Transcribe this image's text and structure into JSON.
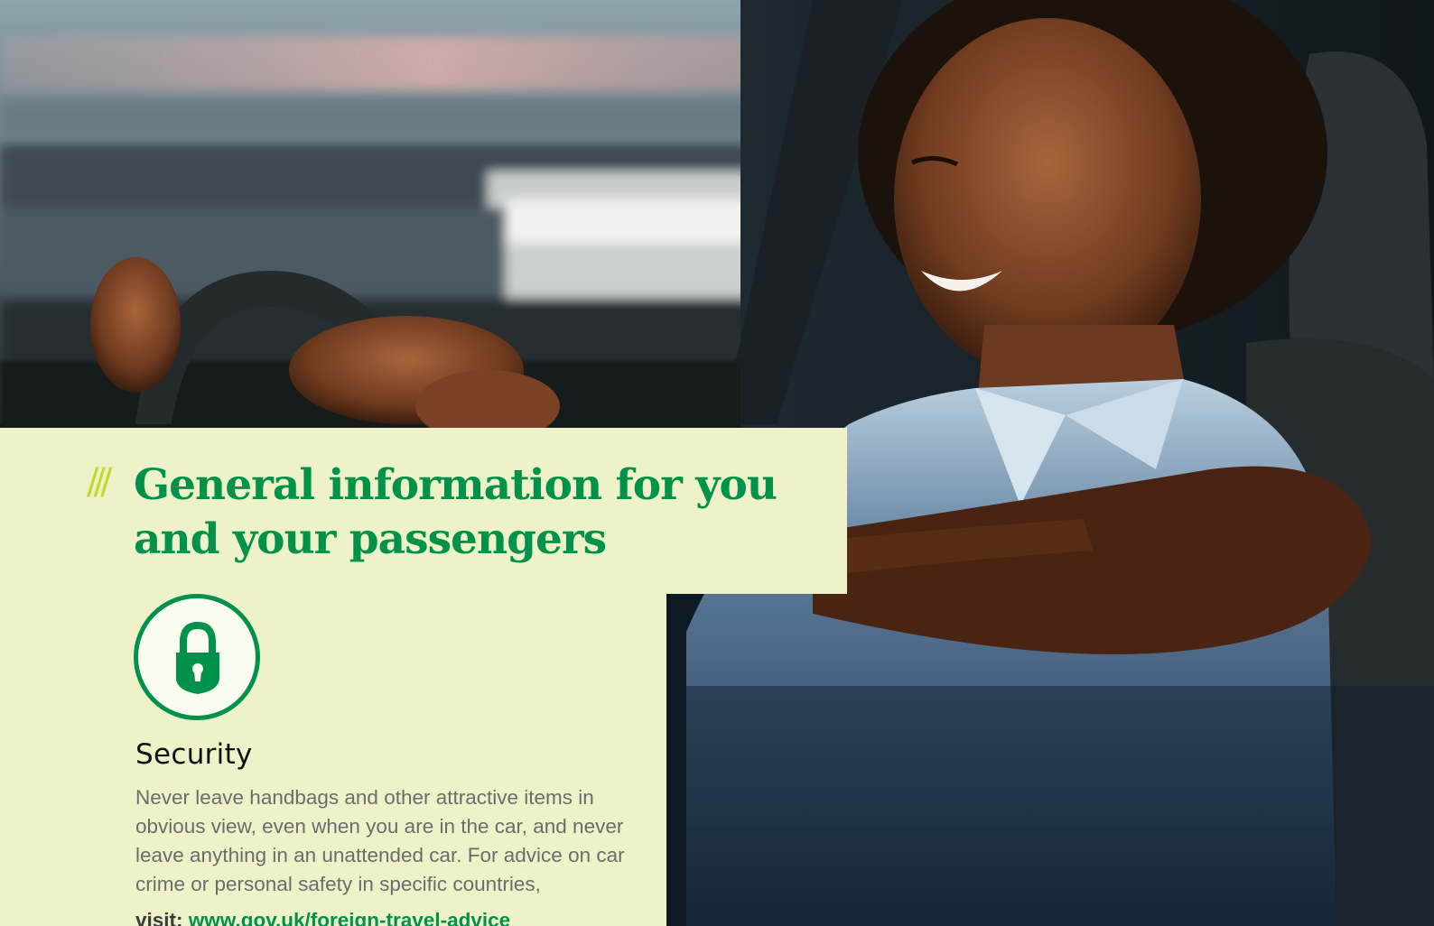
{
  "hero": {
    "description_icon": "photo-woman-driving"
  },
  "heading": {
    "prefix": "///",
    "title": "General information for you and your passengers"
  },
  "security": {
    "icon": "padlock-icon",
    "title": "Security",
    "body": "Never leave handbags and other attractive items in obvious view, even when you are in the car, and never leave anything in an unattended car. For advice on car crime or personal safety in specific countries,",
    "visit_label": "visit: ",
    "link_text": "www.gov.uk/foreign-travel-advice"
  },
  "colors": {
    "brand_green": "#00924a",
    "panel_bg": "#eef2c9",
    "accent_lime": "#c7d72e"
  }
}
